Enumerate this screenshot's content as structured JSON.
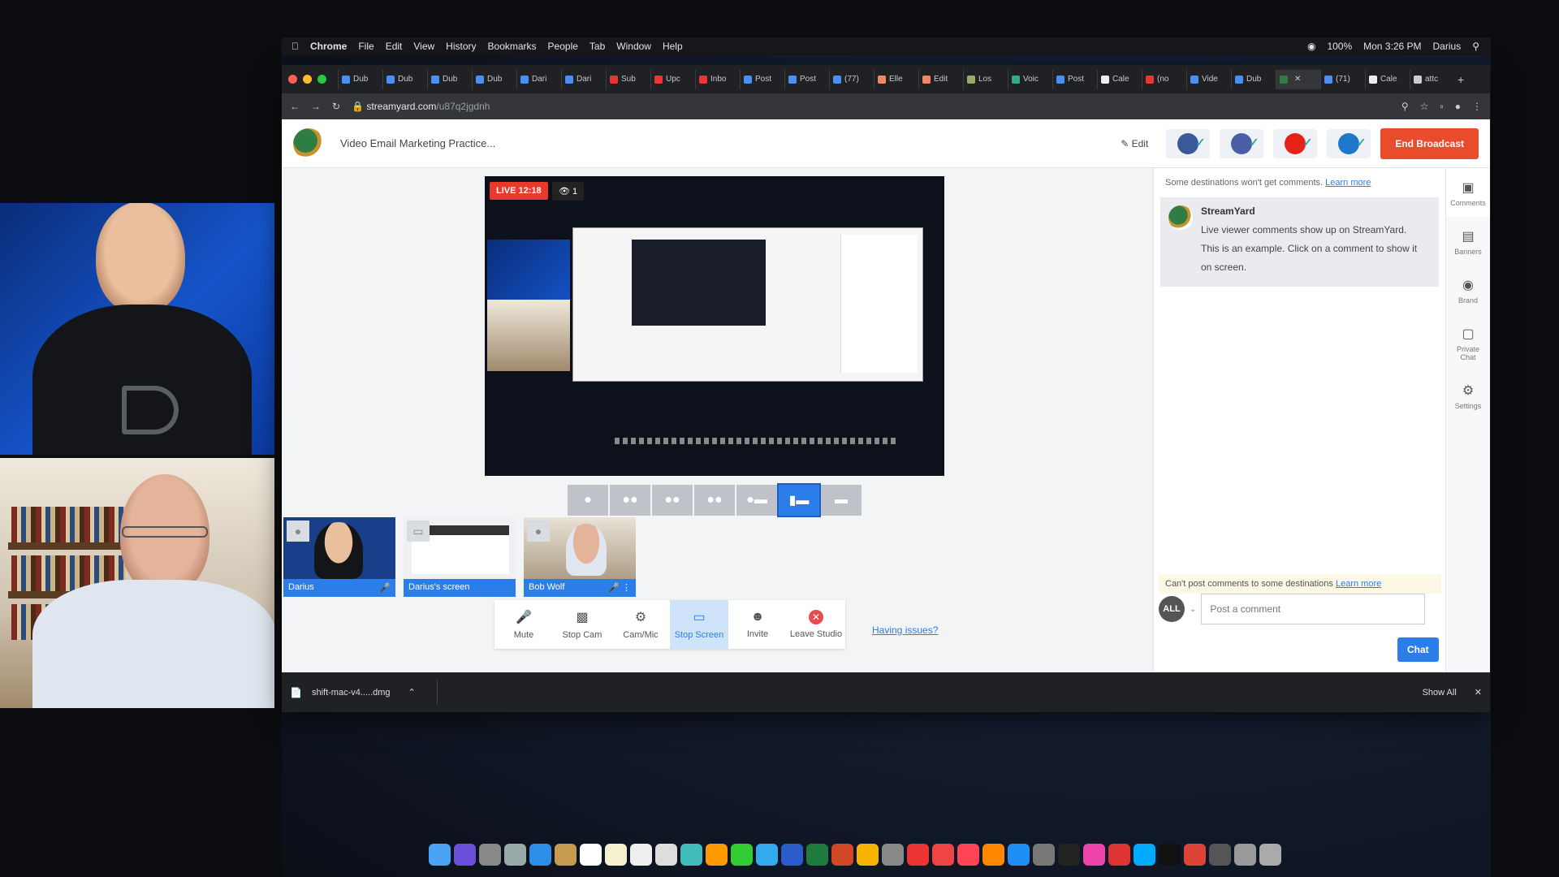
{
  "menubar": {
    "app": "Chrome",
    "items": [
      "File",
      "Edit",
      "View",
      "History",
      "Bookmarks",
      "People",
      "Tab",
      "Window",
      "Help"
    ],
    "battery": "100%",
    "clock": "Mon 3:26 PM",
    "user": "Darius"
  },
  "tabs": [
    "Dub",
    "Dub",
    "Dub",
    "Dub",
    "Dari",
    "Dari",
    "Sub",
    "Upc",
    "Inbo",
    "Post",
    "Post",
    "(77)",
    "Elle",
    "Edit",
    "Los",
    "Voic",
    "Post",
    "Cale",
    "(no",
    "Vide",
    "Dub",
    "",
    "(71)",
    "Cale",
    "attc"
  ],
  "address": {
    "domain": "streamyard.com",
    "path": "/u87q2jgdnh"
  },
  "app": {
    "title": "Video Email Marketing Practice...",
    "edit_label": "Edit",
    "end_label": "End Broadcast",
    "live_label": "LIVE 12:18",
    "viewers": "1"
  },
  "tiles": [
    {
      "label": "Darius"
    },
    {
      "label": "Darius's screen"
    },
    {
      "label": "Bob Wolf"
    }
  ],
  "controls": [
    {
      "label": "Mute",
      "icon": "microphone-icon"
    },
    {
      "label": "Stop Cam",
      "icon": "camera-icon"
    },
    {
      "label": "Cam/Mic",
      "icon": "gear-icon"
    },
    {
      "label": "Stop Screen",
      "icon": "monitor-icon"
    },
    {
      "label": "Invite",
      "icon": "add-person-icon"
    },
    {
      "label": "Leave Studio",
      "icon": "close-icon"
    }
  ],
  "issues_link": "Having issues?",
  "comments": {
    "notice": "Some destinations won't get comments.",
    "notice_link": "Learn more",
    "author": "StreamYard",
    "lines": [
      "Live viewer comments show up on StreamYard.",
      "This is an example. Click on a comment to show it",
      "on screen."
    ],
    "footnote": "Can't post comments to some destinations",
    "footnote_link": "Learn more",
    "all_label": "ALL",
    "placeholder": "Post a comment",
    "chat_label": "Chat"
  },
  "rail": [
    {
      "label": "Comments",
      "icon": "comment-icon"
    },
    {
      "label": "Banners",
      "icon": "banner-icon"
    },
    {
      "label": "Brand",
      "icon": "palette-icon"
    },
    {
      "label": "Private Chat",
      "icon": "private-chat-icon"
    },
    {
      "label": "Settings",
      "icon": "gear-icon"
    }
  ],
  "download": {
    "file": "shift-mac-v4.....dmg",
    "show_all": "Show All"
  },
  "colors": {
    "accent": "#2b7de9",
    "end_broadcast": "#e84c2c",
    "live": "#e8392a"
  }
}
